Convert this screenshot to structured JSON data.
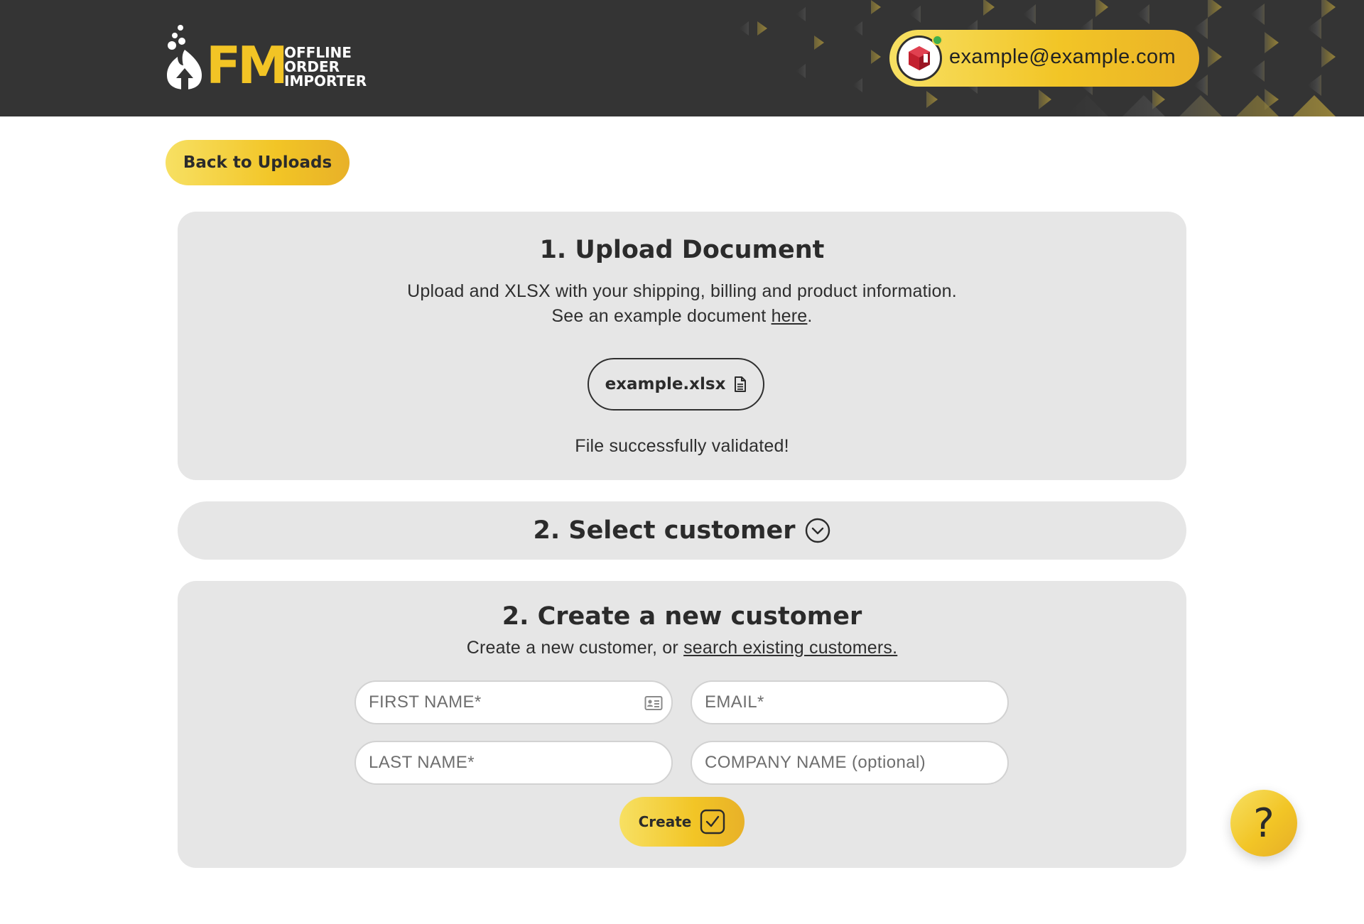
{
  "header": {
    "logo": {
      "mark": "FM",
      "line1": "OFFLINE",
      "line2": "ORDER",
      "line3": "IMPORTER"
    },
    "account": {
      "email": "example@example.com",
      "avatar_icon": "store-logo-icon",
      "status": "online"
    }
  },
  "back_button": {
    "label": "Back to Uploads"
  },
  "upload": {
    "title": "1. Upload Document",
    "description": "Upload and XLSX with your shipping, billing and product information.",
    "example_prefix": "See an example document ",
    "example_link": "here",
    "example_suffix": ".",
    "file_name": "example.xlsx",
    "file_icon": "document-icon",
    "status": "File successfully validated!"
  },
  "select_customer": {
    "title": "2. Select customer",
    "icon": "chevron-down-circle-icon"
  },
  "create_customer": {
    "title": "2. Create a new customer",
    "subtitle_prefix": "Create a new customer, or ",
    "subtitle_link": "search existing customers.",
    "fields": {
      "first_name": {
        "placeholder": "FIRST NAME*",
        "value": "",
        "icon": "contact-card-icon"
      },
      "email": {
        "placeholder": "EMAIL*",
        "value": ""
      },
      "last_name": {
        "placeholder": "LAST NAME*",
        "value": ""
      },
      "company": {
        "placeholder": "COMPANY NAME (optional)",
        "value": ""
      }
    },
    "create_button": {
      "label": "Create",
      "icon": "checkbox-check-icon"
    }
  },
  "help_button": {
    "label": "?"
  },
  "colors": {
    "header_bg": "#343434",
    "accent_yellow": "#f2c526",
    "panel_bg": "#e6e6e6",
    "status_green": "#3fae4c",
    "avatar_red": "#c3202f"
  }
}
